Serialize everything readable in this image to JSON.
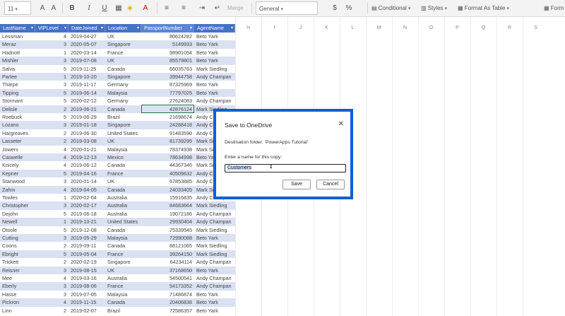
{
  "toolbar": {
    "font_size": "11",
    "bold": "B",
    "italic": "I",
    "underline": "U",
    "merge": "Merge",
    "number_format": "General",
    "currency": "$",
    "conditional": "Conditional",
    "styles": "Styles",
    "format_as_table": "Format As Table",
    "format": "Form"
  },
  "grid": {
    "columns": [
      "H",
      "I",
      "J",
      "K",
      "L",
      "M",
      "N",
      "O",
      "P",
      "Q",
      "R",
      "S"
    ]
  },
  "table": {
    "headers": [
      "LastName",
      "VIPLevel",
      "DateJoined",
      "Location",
      "PassportNumber",
      "AgentName"
    ],
    "rows": [
      [
        "Lessman",
        "4",
        "2019-04-27",
        "UK",
        "80624282",
        "Beto Yark"
      ],
      [
        "Meraz",
        "3",
        "2020-05-07",
        "Singapore",
        "5149933",
        "Beto Yark"
      ],
      [
        "Hadnott",
        "1",
        "2020-03-14",
        "France",
        "98901054",
        "Beto Yark"
      ],
      [
        "Mishler",
        "3",
        "2019-07-08",
        "UK",
        "85579801",
        "Beto Yark"
      ],
      [
        "Salva",
        "5",
        "2019-11-25",
        "Canada",
        "66035763",
        "Mark Siedling"
      ],
      [
        "Partee",
        "1",
        "2019-10-20",
        "Singapore",
        "39944758",
        "Andy Champan"
      ],
      [
        "Tharpe",
        "3",
        "2019-11-17",
        "Germany",
        "87325969",
        "Beto Yark"
      ],
      [
        "Tipping",
        "5",
        "2019-06-14",
        "Malaysia",
        "77797025",
        "Beto Yark"
      ],
      [
        "Stormant",
        "5",
        "2020-02-12",
        "Germany",
        "27624083",
        "Andy Champan"
      ],
      [
        "Delisle",
        "2",
        "2019-06-21",
        "Canada",
        "42876124",
        "Mark Siedling"
      ],
      [
        "Roebuck",
        "5",
        "2019-06-29",
        "Brazil",
        "21698674",
        "Andy Champan"
      ],
      [
        "Lozano",
        "3",
        "2019-01-18",
        "Singapore",
        "24288418",
        "Andy Champan"
      ],
      [
        "Hargreaves",
        "2",
        "2019-06-30",
        "United States",
        "91483590",
        "Andy Champan"
      ],
      [
        "Lasseter",
        "2",
        "2019-03-08",
        "UK",
        "81739295",
        "Mark Siedling"
      ],
      [
        "Jowers",
        "4",
        "2020-01-21",
        "Malaysia",
        "78374938",
        "Mark Siedling"
      ],
      [
        "Caswelle",
        "4",
        "2019-12-13",
        "Mexico",
        "78634998",
        "Beto Yark"
      ],
      [
        "Knicely",
        "4",
        "2019-06-12",
        "Canada",
        "44367346",
        "Mark Siedling"
      ],
      [
        "Kepner",
        "5",
        "2019-04-16",
        "France",
        "40509632",
        "Andy Champan"
      ],
      [
        "Stanwood",
        "3",
        "2020-01-14",
        "UK",
        "67853885",
        "Andy Champan"
      ],
      [
        "Zahm",
        "4",
        "2019-04-05",
        "Canada",
        "24033405",
        "Mark Siedling"
      ],
      [
        "Towles",
        "1",
        "2020-02-04",
        "Australia",
        "15916835",
        "Andy Champan"
      ],
      [
        "Christopher",
        "3",
        "2020-02-17",
        "Australia",
        "84683664",
        "Mark Siedling"
      ],
      [
        "Dejohn",
        "5",
        "2019-06-18",
        "Australia",
        "19072186",
        "Andy Champan"
      ],
      [
        "Newell",
        "1",
        "2019-10-21",
        "United States",
        "29930404",
        "Andy Champan"
      ],
      [
        "Otoole",
        "5",
        "2019-12-08",
        "Canada",
        "75339545",
        "Mark Siedling"
      ],
      [
        "Cutting",
        "3",
        "2019-05-29",
        "Malaysia",
        "72990088",
        "Beto Yark"
      ],
      [
        "Coons",
        "2",
        "2019-09-11",
        "Canada",
        "88121065",
        "Mark Siedling"
      ],
      [
        "Ebright",
        "5",
        "2019-05-04",
        "France",
        "39264150",
        "Mark Siedling"
      ],
      [
        "Trickett",
        "2",
        "2020-02-19",
        "Singapore",
        "64234114",
        "Andy Champan"
      ],
      [
        "Reisner",
        "3",
        "2019-08-15",
        "UK",
        "37168650",
        "Beto Yark"
      ],
      [
        "Mee",
        "4",
        "2019-03-16",
        "Australia",
        "54500541",
        "Andy Champan"
      ],
      [
        "Eberly",
        "3",
        "2019-08-06",
        "France",
        "54173352",
        "Andy Champan"
      ],
      [
        "Hasse",
        "3",
        "2019-07-05",
        "Malaysia",
        "71486874",
        "Beto Yark"
      ],
      [
        "Pickron",
        "4",
        "2019-11-15",
        "Canada",
        "20406838",
        "Beto Yark"
      ],
      [
        "Linn",
        "2",
        "2019-02-07",
        "Brazil",
        "72586357",
        "Beto Yark"
      ]
    ]
  },
  "dialog": {
    "title": "Save to OneDrive",
    "close": "✕",
    "destination": "Destination folder: 'PowerApps Tutorial'",
    "name_label": "Enter a name for this copy:",
    "name_value": "Customers",
    "save": "Save",
    "cancel": "Cancel"
  }
}
